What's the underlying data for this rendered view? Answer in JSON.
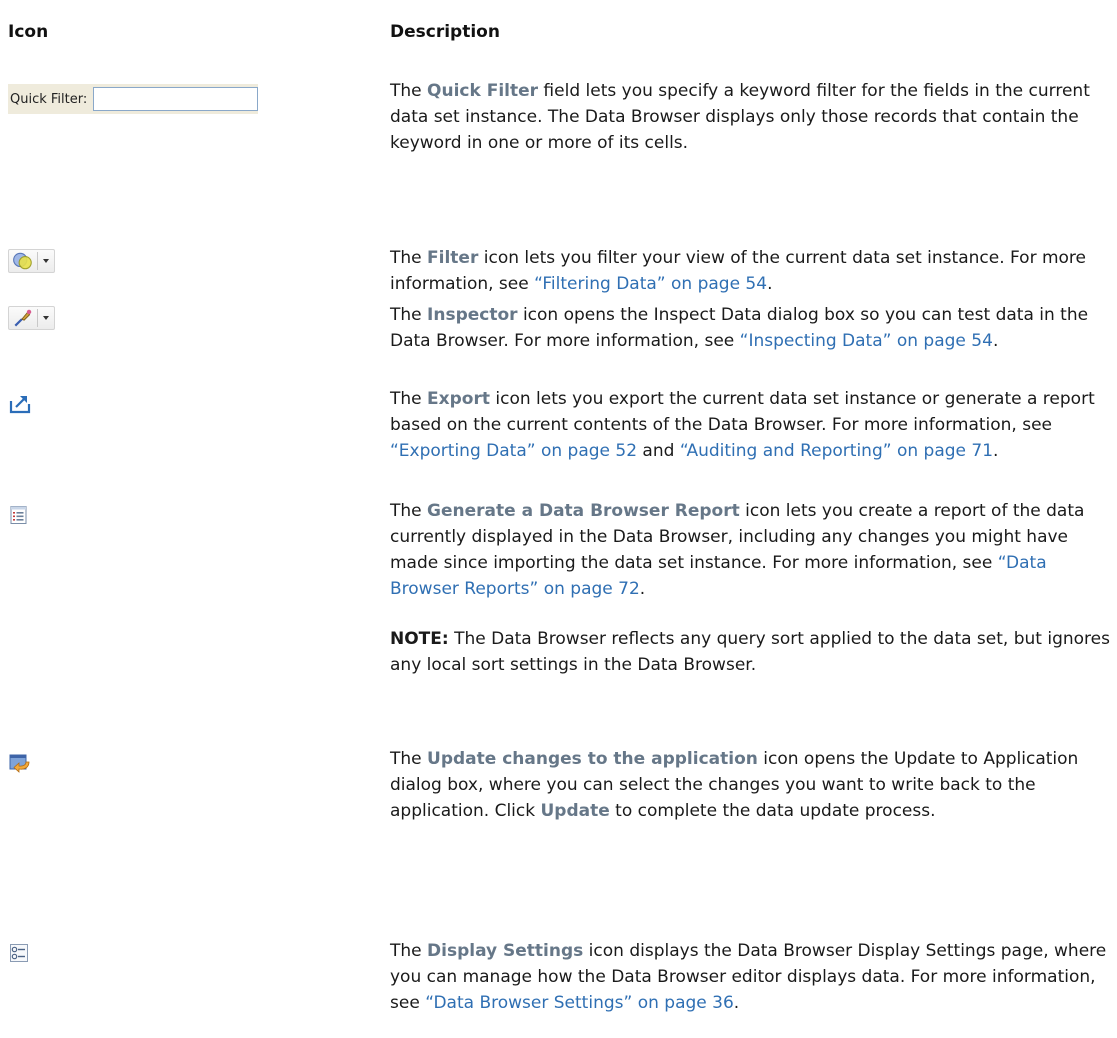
{
  "headers": {
    "icon": "Icon",
    "description": "Description"
  },
  "quick_filter": {
    "label": "Quick Filter:",
    "value": ""
  },
  "rows": {
    "quick_filter": {
      "t1": "The ",
      "kw": "Quick Filter",
      "t2": " field lets you specify a keyword filter for the fields in the current data set instance. The Data Browser displays only those records that contain the keyword in one or more of its cells."
    },
    "filter": {
      "icon": "filter-icon",
      "t1": "The ",
      "kw": "Filter",
      "t2": " icon lets you filter your view of the current data set instance. For more information, see ",
      "link": "“Filtering Data” on page 54",
      "t3": "."
    },
    "inspector": {
      "icon": "inspector-icon",
      "t1": "The ",
      "kw": "Inspector",
      "t2": " icon opens the Inspect Data dialog box so you can test data in the Data Browser. For more information, see ",
      "link": "“Inspecting Data” on page 54",
      "t3": "."
    },
    "export": {
      "icon": "export-icon",
      "t1": "The ",
      "kw": "Export",
      "t2": " icon lets you export the current data set instance or generate a report based on the current contents of the Data Browser. For more information, see ",
      "link1": "“Exporting Data” on page 52",
      "t3": " and ",
      "link2": "“Auditing and Reporting” on page 71",
      "t4": "."
    },
    "report": {
      "icon": "report-icon",
      "t1": "The ",
      "kw": "Generate a Data Browser Report",
      "t2": " icon lets you create a report of the data currently displayed in the Data Browser, including any changes you might have made since importing the data set instance. For more information, see ",
      "link": "“Data Browser Reports” on page 72",
      "t3": ".",
      "note_label": "NOTE:",
      "note_text": " The Data Browser reflects any query sort applied to the data set, but ignores any local sort settings in the Data Browser."
    },
    "update": {
      "icon": "update-icon",
      "t1": "The ",
      "kw": "Update changes to the application",
      "t2": " icon opens the Update to Application dialog box, where you can select the changes you want to write back to the application. Click ",
      "kw2": "Update",
      "t3": " to complete the data update process."
    },
    "display": {
      "icon": "display-settings-icon",
      "t1": "The ",
      "kw": "Display Settings",
      "t2": " icon displays the Data Browser Display Settings page, where you can manage how the Data Browser editor displays data. For more information, see ",
      "link": "“Data Browser Settings” on page 36",
      "t3": "."
    }
  },
  "colors": {
    "keyword": "#667788",
    "link": "#2f6fb3",
    "quick_filter_bg": "#efebdc"
  }
}
